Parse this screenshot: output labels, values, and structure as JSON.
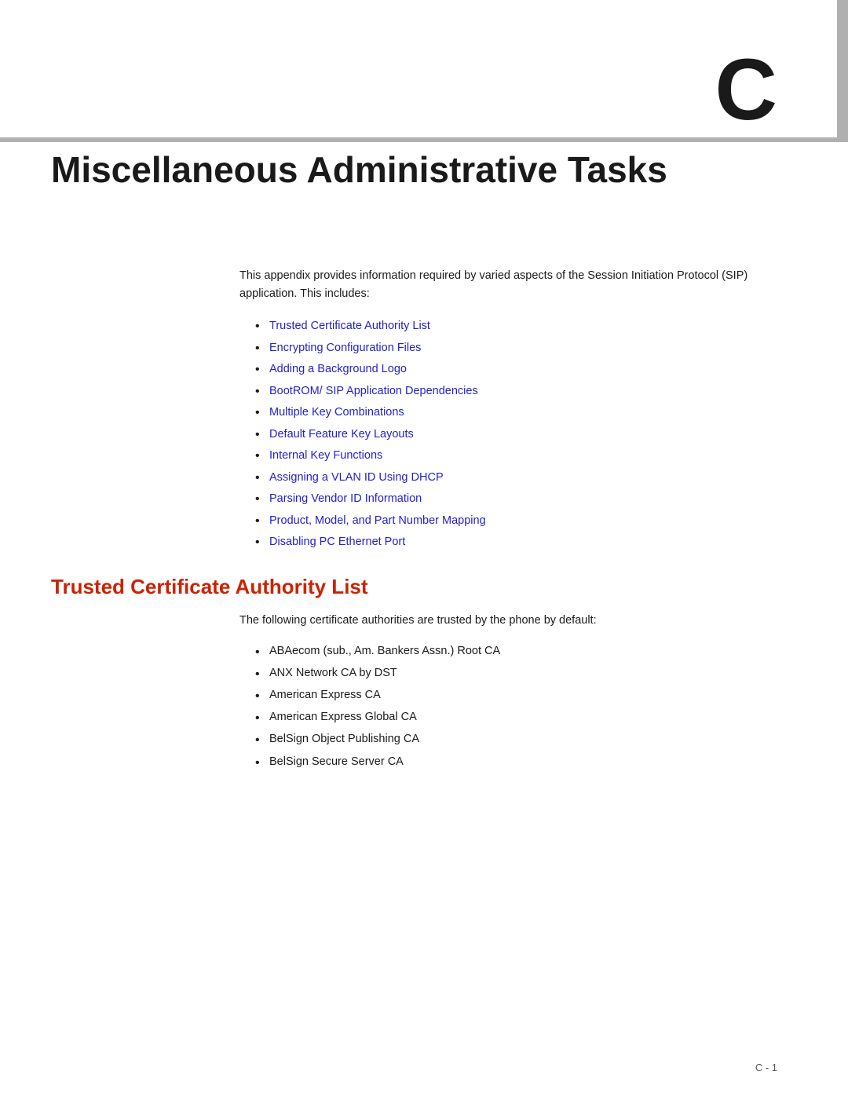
{
  "page": {
    "chapter_letter": "C",
    "chapter_title": "Miscellaneous Administrative Tasks",
    "top_bar_color": "#b0b0b0"
  },
  "intro": {
    "text": "This appendix provides information required by varied aspects of the Session Initiation Protocol (SIP) application. This includes:"
  },
  "toc": {
    "items": [
      {
        "label": "Trusted Certificate Authority List",
        "href": "#trusted-cert"
      },
      {
        "label": "Encrypting Configuration Files",
        "href": "#encrypting"
      },
      {
        "label": "Adding a Background Logo",
        "href": "#background-logo"
      },
      {
        "label": "BootROM/ SIP Application Dependencies",
        "href": "#bootrom"
      },
      {
        "label": "Multiple Key Combinations",
        "href": "#multiple-key"
      },
      {
        "label": "Default Feature Key Layouts",
        "href": "#default-feature"
      },
      {
        "label": "Internal Key Functions",
        "href": "#internal-key"
      },
      {
        "label": "Assigning a VLAN ID Using DHCP",
        "href": "#vlan-id"
      },
      {
        "label": "Parsing Vendor ID Information",
        "href": "#vendor-id"
      },
      {
        "label": "Product, Model, and Part Number Mapping",
        "href": "#product-model"
      },
      {
        "label": "Disabling PC Ethernet Port",
        "href": "#disabling-pc"
      }
    ]
  },
  "section1": {
    "heading": "Trusted Certificate Authority List",
    "intro": "The following certificate authorities are trusted by the phone by default:",
    "items": [
      "ABAecom (sub., Am. Bankers Assn.) Root CA",
      "ANX Network CA by DST",
      "American Express CA",
      "American Express Global CA",
      "BelSign Object Publishing CA",
      "BelSign Secure Server CA"
    ]
  },
  "footer": {
    "page_label": "C - 1"
  }
}
